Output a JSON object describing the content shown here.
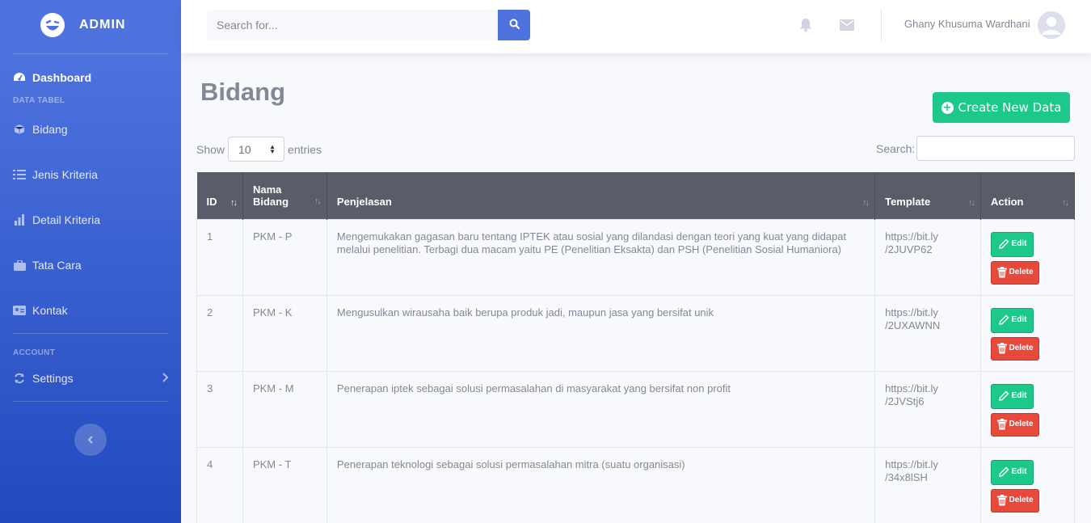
{
  "sidebar": {
    "brand": "ADMIN",
    "dashboard": "Dashboard",
    "heading_data": "DATA TABEL",
    "items": [
      {
        "label": "Bidang",
        "icon": "cube-icon"
      },
      {
        "label": "Jenis Kriteria",
        "icon": "list-check-icon"
      },
      {
        "label": "Detail Kriteria",
        "icon": "chart-icon"
      },
      {
        "label": "Tata Cara",
        "icon": "briefcase-icon"
      },
      {
        "label": "Kontak",
        "icon": "id-card-icon"
      }
    ],
    "heading_account": "ACCOUNT",
    "settings": "Settings"
  },
  "topbar": {
    "search_placeholder": "Search for...",
    "user_name": "Ghany Khusuma Wardhani"
  },
  "page": {
    "title": "Bidang",
    "create_label": "Create New Data",
    "show_label": "Show",
    "entries_value": "10",
    "entries_label": "entries",
    "search_label": "Search:"
  },
  "table": {
    "headers": [
      "ID",
      "Nama Bidang",
      "Penjelasan",
      "Template",
      "Action"
    ],
    "edit_label": "Edit",
    "delete_label": "Delete",
    "rows": [
      {
        "id": "1",
        "nama": "PKM - P",
        "penjelasan": "Mengemukakan gagasan baru tentang IPTEK atau sosial yang dilandasi dengan teori yang kuat yang didapat melalui penelitian. Terbagi dua macam yaitu PE (Penelitian Eksakta) dan PSH (Penelitian Sosial Humaniora)",
        "template_1": "https://bit.ly",
        "template_2": "/2JUVP62"
      },
      {
        "id": "2",
        "nama": "PKM - K",
        "penjelasan": "Mengusulkan wirausaha baik berupa produk jadi, maupun jasa yang bersifat unik",
        "template_1": "https://bit.ly",
        "template_2": "/2UXAWNN"
      },
      {
        "id": "3",
        "nama": "PKM - M",
        "penjelasan": "Penerapan iptek sebagai solusi permasalahan di masyarakat yang bersifat non profit",
        "template_1": "https://bit.ly",
        "template_2": "/2JVStj6"
      },
      {
        "id": "4",
        "nama": "PKM - T",
        "penjelasan": "Penerapan teknologi sebagai solusi permasalahan mitra (suatu organisasi)",
        "template_1": "https://bit.ly",
        "template_2": "/34x8lSH"
      }
    ]
  }
}
